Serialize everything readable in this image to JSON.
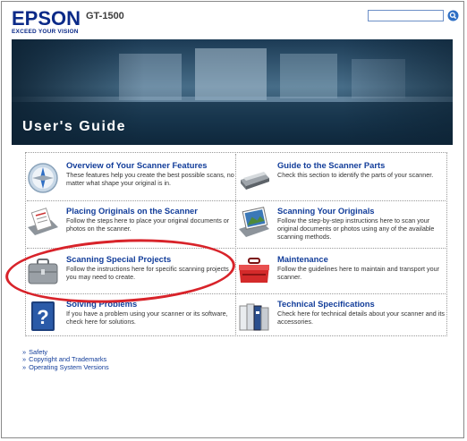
{
  "header": {
    "logo": "EPSON",
    "tagline": "EXCEED YOUR VISION",
    "model": "GT-1500",
    "search": {
      "value": "",
      "placeholder": ""
    }
  },
  "banner": {
    "title": "User's Guide"
  },
  "sections": [
    {
      "title": "Overview of Your Scanner Features",
      "description": "These features help you create the best possible scans, no matter what shape your original is in.",
      "icon": "compass-icon"
    },
    {
      "title": "Guide to the Scanner Parts",
      "description": "Check this section to identify the parts of your scanner.",
      "icon": "scanner-icon"
    },
    {
      "title": "Placing Originals on the Scanner",
      "description": "Follow the steps here to place your original documents or photos on the scanner.",
      "icon": "document-on-scanner-icon"
    },
    {
      "title": "Scanning Your Originals",
      "description": "Follow the step-by-step instructions here to scan your original documents or photos using any of the available scanning methods.",
      "icon": "photo-icon"
    },
    {
      "title": "Scanning Special Projects",
      "description": "Follow the instructions here for specific scanning projects you may need to create.",
      "icon": "briefcase-icon"
    },
    {
      "title": "Maintenance",
      "description": "Follow the guidelines here to maintain and transport your scanner.",
      "icon": "toolbox-icon"
    },
    {
      "title": "Solving Problems",
      "description": "If you have a problem using your scanner or its software, check here for solutions.",
      "icon": "question-book-icon"
    },
    {
      "title": "Technical Specifications",
      "description": "Check here for technical details about your scanner and its accessories.",
      "icon": "binders-icon"
    }
  ],
  "links": [
    "Safety",
    "Copyright and Trademarks",
    "Operating System Versions"
  ],
  "colors": {
    "brand": "#0b2a88",
    "link": "#123d9a",
    "highlight": "#d8232a"
  }
}
